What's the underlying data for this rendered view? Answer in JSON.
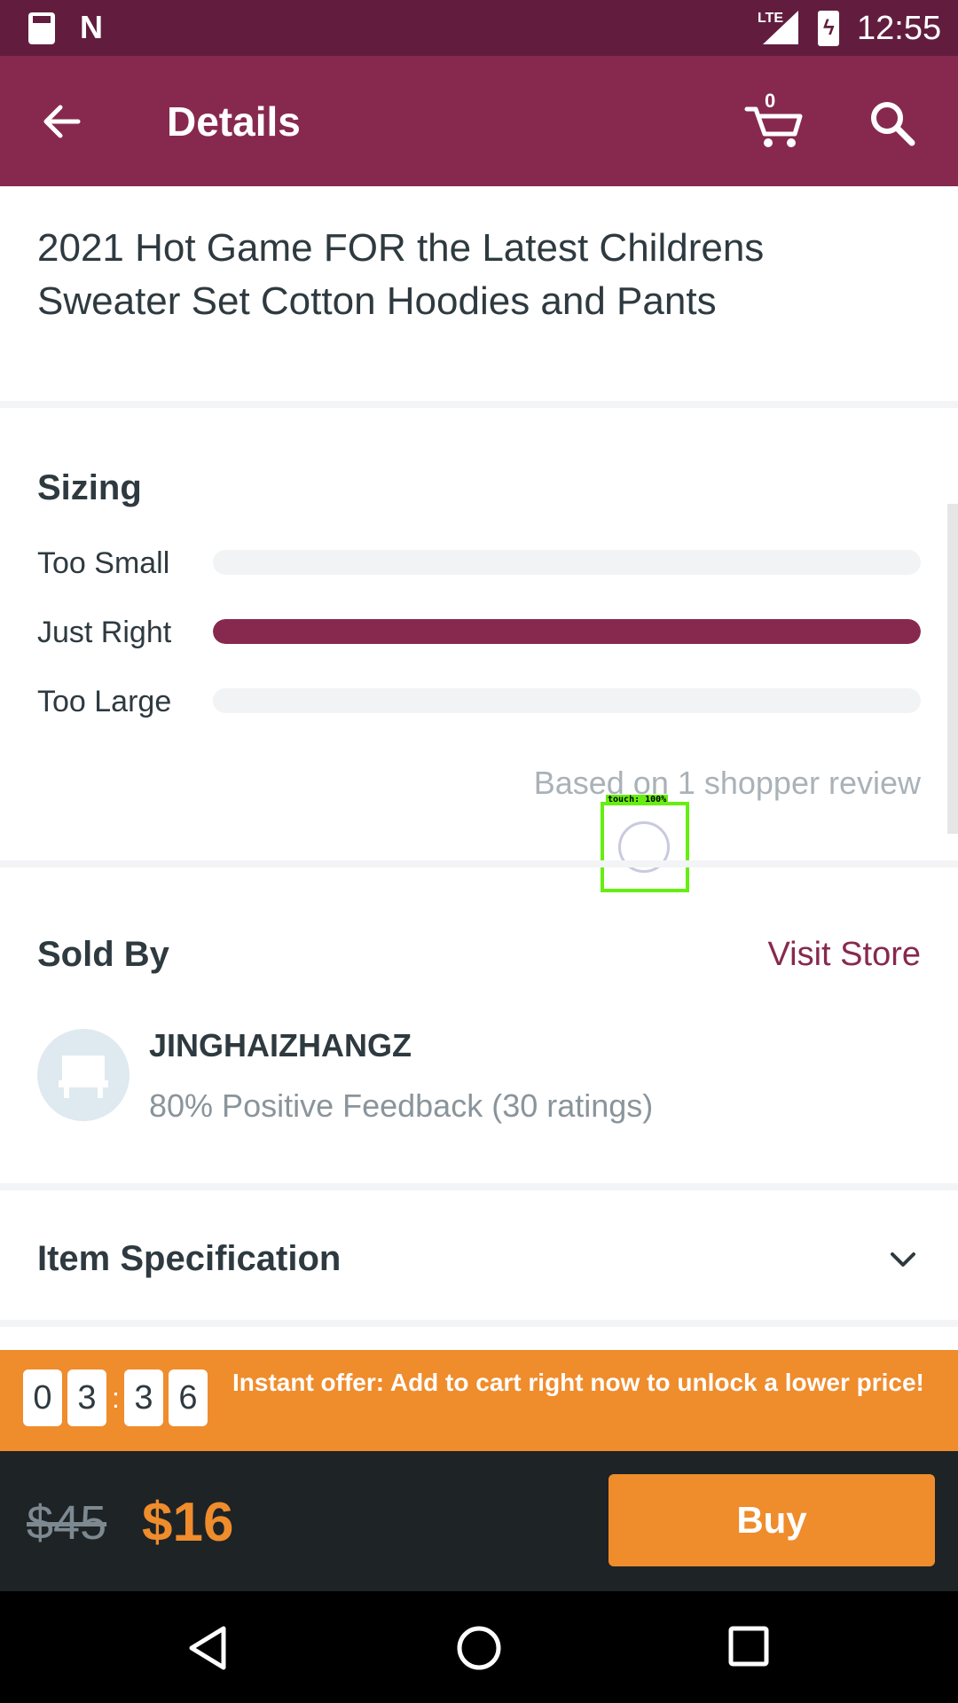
{
  "status_bar": {
    "time": "12:55",
    "network": "LTE",
    "icons": [
      "sd-card-icon",
      "n-logo-icon",
      "signal-icon",
      "battery-charging-icon"
    ]
  },
  "app_bar": {
    "title": "Details",
    "cart_count": "0",
    "icons": [
      "back-arrow-icon",
      "cart-icon",
      "search-icon"
    ]
  },
  "product": {
    "title": "2021 Hot Game FOR the Latest Childrens Sweater Set Cotton Hoodies and Pants"
  },
  "sizing": {
    "heading": "Sizing",
    "rows": [
      {
        "label": "Too Small",
        "fraction": 0
      },
      {
        "label": "Just Right",
        "fraction": 1
      },
      {
        "label": "Too Large",
        "fraction": 0
      }
    ],
    "note": "Based on 1 shopper review",
    "bar_color": "#87294f"
  },
  "touch_indicator": {
    "label": "touch: 100%"
  },
  "sold_by": {
    "heading": "Sold By",
    "visit_store": "Visit Store",
    "store_name": "JINGHAIZHANGZ",
    "feedback": "80% Positive Feedback (30 ratings)"
  },
  "item_spec": {
    "heading": "Item Specification"
  },
  "offer": {
    "timer": [
      "0",
      "3",
      "3",
      "6"
    ],
    "separator": ":",
    "text": "Instant offer: Add to cart right now to unlock a lower price!",
    "color": "#ef8c2c"
  },
  "price": {
    "original": "$45",
    "current": "$16",
    "buy_label": "Buy"
  },
  "colors": {
    "brand": "#87294f",
    "status_bar": "#621d3e",
    "accent": "#ef8c2c"
  }
}
